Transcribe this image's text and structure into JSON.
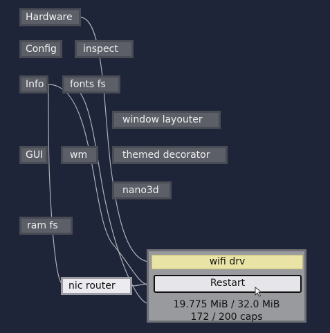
{
  "nodes": {
    "hardware": "Hardware",
    "config": "Config",
    "inspect": "inspect",
    "info": "Info",
    "fonts_fs": "fonts fs",
    "window_layouter": "window layouter",
    "gui": "GUI",
    "wm": "wm",
    "themed_decorator": "themed decorator",
    "nano3d": "nano3d",
    "ram_fs": "ram fs",
    "nic_router": "nic router"
  },
  "panel": {
    "title": "wifi drv",
    "restart_label": "Restart",
    "ram": "19.775 MiB / 32.0 MiB",
    "caps": "172 / 200 caps"
  },
  "colors": {
    "background": "#1f2538",
    "node_fill": "#5c5f68",
    "selected_fill": "#ececf0",
    "panel_title_fill": "#e9e4a5",
    "wire": "#c8c9cf"
  },
  "icons": {
    "pointer": "arrow-cursor-icon"
  }
}
